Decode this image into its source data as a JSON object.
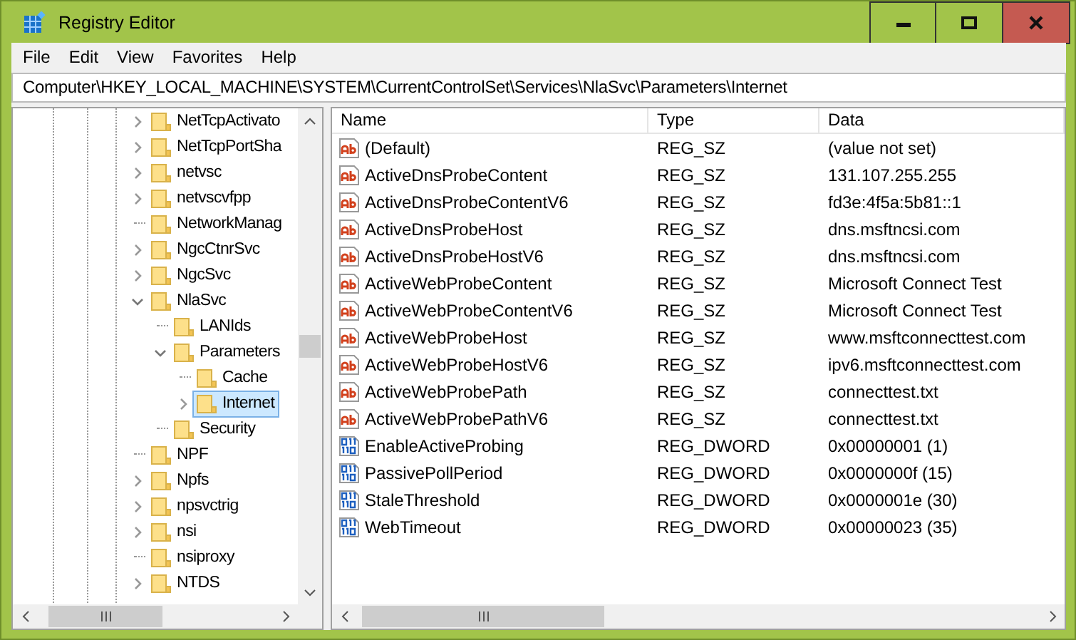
{
  "window": {
    "title": "Registry Editor"
  },
  "menu": [
    "File",
    "Edit",
    "View",
    "Favorites",
    "Help"
  ],
  "address": "Computer\\HKEY_LOCAL_MACHINE\\SYSTEM\\CurrentControlSet\\Services\\NlaSvc\\Parameters\\Internet",
  "tree": [
    {
      "label": "NetTcpActivato",
      "expandable": true,
      "expanded": false,
      "selected": false
    },
    {
      "label": "NetTcpPortSha",
      "expandable": true,
      "expanded": false,
      "selected": false
    },
    {
      "label": "netvsc",
      "expandable": true,
      "expanded": false,
      "selected": false
    },
    {
      "label": "netvscvfpp",
      "expandable": true,
      "expanded": false,
      "selected": false
    },
    {
      "label": "NetworkManag",
      "expandable": false,
      "selected": false
    },
    {
      "label": "NgcCtnrSvc",
      "expandable": true,
      "expanded": false,
      "selected": false
    },
    {
      "label": "NgcSvc",
      "expandable": true,
      "expanded": false,
      "selected": false
    },
    {
      "label": "NlaSvc",
      "expandable": true,
      "expanded": true,
      "selected": false,
      "children": [
        {
          "label": "LANIds",
          "expandable": false,
          "selected": false
        },
        {
          "label": "Parameters",
          "expandable": true,
          "expanded": true,
          "selected": false,
          "children": [
            {
              "label": "Cache",
              "expandable": false,
              "selected": false
            },
            {
              "label": "Internet",
              "expandable": true,
              "expanded": false,
              "selected": true
            }
          ]
        },
        {
          "label": "Security",
          "expandable": false,
          "selected": false
        }
      ]
    },
    {
      "label": "NPF",
      "expandable": false,
      "selected": false
    },
    {
      "label": "Npfs",
      "expandable": true,
      "expanded": false,
      "selected": false
    },
    {
      "label": "npsvctrig",
      "expandable": true,
      "expanded": false,
      "selected": false
    },
    {
      "label": "nsi",
      "expandable": true,
      "expanded": false,
      "selected": false
    },
    {
      "label": "nsiproxy",
      "expandable": false,
      "selected": false
    },
    {
      "label": "NTDS",
      "expandable": true,
      "expanded": false,
      "selected": false
    }
  ],
  "columns": [
    "Name",
    "Type",
    "Data"
  ],
  "values": [
    {
      "kind": "string",
      "name": "(Default)",
      "type": "REG_SZ",
      "data": "(value not set)"
    },
    {
      "kind": "string",
      "name": "ActiveDnsProbeContent",
      "type": "REG_SZ",
      "data": "131.107.255.255"
    },
    {
      "kind": "string",
      "name": "ActiveDnsProbeContentV6",
      "type": "REG_SZ",
      "data": "fd3e:4f5a:5b81::1"
    },
    {
      "kind": "string",
      "name": "ActiveDnsProbeHost",
      "type": "REG_SZ",
      "data": "dns.msftncsi.com"
    },
    {
      "kind": "string",
      "name": "ActiveDnsProbeHostV6",
      "type": "REG_SZ",
      "data": "dns.msftncsi.com"
    },
    {
      "kind": "string",
      "name": "ActiveWebProbeContent",
      "type": "REG_SZ",
      "data": "Microsoft Connect Test"
    },
    {
      "kind": "string",
      "name": "ActiveWebProbeContentV6",
      "type": "REG_SZ",
      "data": "Microsoft Connect Test"
    },
    {
      "kind": "string",
      "name": "ActiveWebProbeHost",
      "type": "REG_SZ",
      "data": "www.msftconnecttest.com"
    },
    {
      "kind": "string",
      "name": "ActiveWebProbeHostV6",
      "type": "REG_SZ",
      "data": "ipv6.msftconnecttest.com"
    },
    {
      "kind": "string",
      "name": "ActiveWebProbePath",
      "type": "REG_SZ",
      "data": "connecttest.txt"
    },
    {
      "kind": "string",
      "name": "ActiveWebProbePathV6",
      "type": "REG_SZ",
      "data": "connecttest.txt"
    },
    {
      "kind": "dword",
      "name": "EnableActiveProbing",
      "type": "REG_DWORD",
      "data": "0x00000001 (1)"
    },
    {
      "kind": "dword",
      "name": "PassivePollPeriod",
      "type": "REG_DWORD",
      "data": "0x0000000f (15)"
    },
    {
      "kind": "dword",
      "name": "StaleThreshold",
      "type": "REG_DWORD",
      "data": "0x0000001e (30)"
    },
    {
      "kind": "dword",
      "name": "WebTimeout",
      "type": "REG_DWORD",
      "data": "0x00000023 (35)"
    }
  ]
}
